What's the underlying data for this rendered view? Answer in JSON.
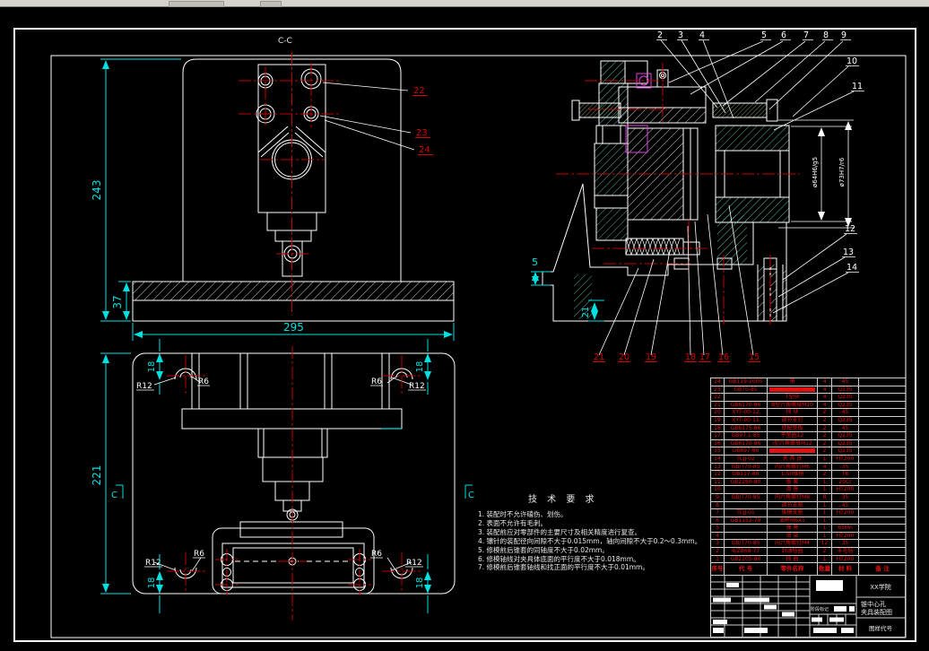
{
  "front_view": {
    "section_label": "C-C",
    "dim_height": "243",
    "dim_base": "37",
    "dim_width": "295",
    "balloon_22": "22",
    "balloon_23": "23",
    "balloon_24": "24"
  },
  "top_view": {
    "dim_height": "221",
    "dim_18": "18",
    "r12": "R12",
    "r6": "R6",
    "section_mark": "C"
  },
  "section_view": {
    "balloons_top": [
      "2",
      "3",
      "4",
      "5",
      "6",
      "7",
      "8",
      "9"
    ],
    "balloons_right": [
      "10",
      "11",
      "12",
      "13",
      "14"
    ],
    "balloons_bottom": [
      "21",
      "20",
      "19",
      "18",
      "17",
      "16",
      "15"
    ],
    "dim_5": "5",
    "dim_21": "21",
    "dim_bore_inner": "ø64H6/g5",
    "dim_bore_outer": "ø73H7/r6"
  },
  "tech": {
    "title": "技 术 要 求",
    "items": [
      "1. 装配时不允许磕伤、划伤。",
      "2. 表面不允许有毛刺。",
      "3. 装配前应对零部件的主要尺寸及相关精度进行复查。",
      "4. 镶针的装配径向间隙不大于0.015mm，轴向间隙不大于0.2～0.3mm。",
      "5. 修模前后锥套的同轴度不大于0.02mm。",
      "6. 修模轴线对夹具体底面的平行度不大于0.018mm。",
      "7. 修模前后锥套轴线和找正面的平行度不大于0.01mm。"
    ]
  },
  "bom": {
    "headers": [
      "序号",
      "代 号",
      "零件名称",
      "数量",
      "材 料",
      "备 注"
    ],
    "rows": [
      {
        "no": "24",
        "code": "GB119-2000",
        "name": "销",
        "qty": "4",
        "mat": "45",
        "note": ""
      },
      {
        "no": "23",
        "code": "GB70-85",
        "name": "",
        "bar": true,
        "qty": "4",
        "mat": "Q235",
        "note": ""
      },
      {
        "no": "22",
        "code": "",
        "name": "T型块",
        "qty": "4",
        "mat": "Q235",
        "note": ""
      },
      {
        "no": "21",
        "code": "GB6170-86",
        "name": "Ⅲ型六角螺母M10",
        "qty": "4",
        "mat": "Q235",
        "note": ""
      },
      {
        "no": "20",
        "code": "XYT-00-12",
        "name": "挡 块",
        "qty": "2",
        "mat": "45",
        "note": ""
      },
      {
        "no": "19",
        "code": "XYT-00-11",
        "name": "调节支钉",
        "qty": "2",
        "mat": "Q235",
        "note": ""
      },
      {
        "no": "18",
        "code": "GB6175-86",
        "name": "修配垫板",
        "qty": "2",
        "mat": "45",
        "note": ""
      },
      {
        "no": "17",
        "code": "GB97.1-85",
        "name": "平垫圈12",
        "qty": "2",
        "mat": "Q235",
        "note": ""
      },
      {
        "no": "16",
        "code": "GB6170-86",
        "name": "Ⅰ型六角螺母M12",
        "qty": "2",
        "mat": "Q235",
        "note": ""
      },
      {
        "no": "15",
        "code": "GB897-86",
        "name": "",
        "bar": true,
        "qty": "2",
        "mat": "Q235",
        "note": ""
      },
      {
        "no": "14",
        "code": "TCJJ-02",
        "name": "夹 具 体",
        "qty": "1",
        "mat": "HT200",
        "note": ""
      },
      {
        "no": "13",
        "code": "GB/T70-85",
        "name": "内六角螺钉M6",
        "qty": "4",
        "mat": "35",
        "note": ""
      },
      {
        "no": "12",
        "code": "GB117-86",
        "name": "1:50锥销",
        "qty": "2",
        "mat": "T8",
        "note": ""
      },
      {
        "no": "11",
        "code": "GB2260-80",
        "name": "锥 套",
        "qty": "1",
        "mat": "20Cr",
        "note": ""
      },
      {
        "no": "10",
        "code": "",
        "name": "滑 座",
        "qty": "1",
        "mat": "HT200",
        "note": ""
      },
      {
        "no": "9",
        "code": "GB/T70-85",
        "name": "内六角螺钉M8",
        "qty": "8",
        "mat": "35",
        "note": ""
      },
      {
        "no": "8",
        "code": "",
        "name": "调节支座",
        "qty": "1",
        "mat": "45",
        "note": ""
      },
      {
        "no": "7",
        "code": "TCJJ-01",
        "name": "锥模支座",
        "qty": "1",
        "mat": "HT200",
        "note": ""
      },
      {
        "no": "6",
        "code": "GB1152-79",
        "name": "油杯M6X1",
        "qty": "1",
        "mat": "",
        "note": ""
      },
      {
        "no": "5",
        "code": "",
        "name": "弹 簧",
        "qty": "1",
        "mat": "65Mn",
        "note": ""
      },
      {
        "no": "4",
        "code": "",
        "name": "滑 架",
        "qty": "1",
        "mat": "HT200",
        "note": ""
      },
      {
        "no": "3",
        "code": "GB/T70-85",
        "name": "内六角螺钉M4",
        "qty": "12",
        "mat": "35",
        "note": ""
      },
      {
        "no": "2",
        "code": "4/ZB68-77",
        "name": "封油毡圈",
        "qty": "2",
        "mat": "羊毛毡",
        "note": ""
      },
      {
        "no": "1",
        "code": "GB2205-80",
        "name": "挡 圈",
        "qty": "1",
        "mat": "HT200",
        "note": ""
      }
    ]
  },
  "title_block": {
    "school": "XX学院",
    "title1": "锥中心孔",
    "title2": "夹具装配图",
    "code_label": "图样代号",
    "stage_label": "阶段标记"
  }
}
